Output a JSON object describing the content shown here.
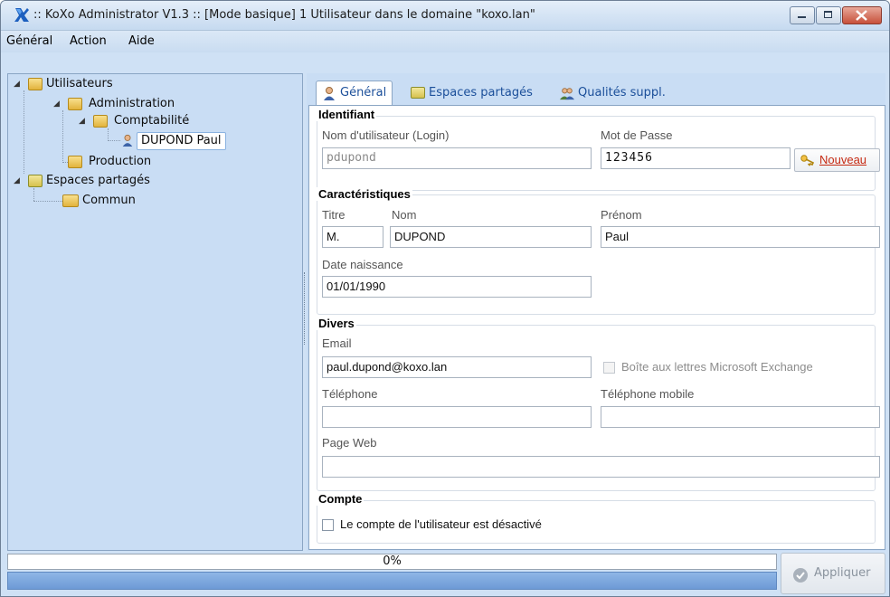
{
  "window": {
    "title": ":: KoXo Administrator V1.3 :: [Mode basique]  1 Utilisateur dans le domaine \"koxo.lan\"",
    "controls": {
      "minimize": "minimize-icon",
      "maximize": "maximize-icon",
      "close": "close-icon"
    }
  },
  "menu": {
    "items": [
      {
        "label": "Général"
      },
      {
        "label": "Action"
      },
      {
        "label": "Aide"
      }
    ]
  },
  "tree": {
    "utilisateurs": "Utilisateurs",
    "administration": "Administration",
    "comptabilite": "Comptabilité",
    "user": "DUPOND Paul",
    "production": "Production",
    "espaces": "Espaces partagés",
    "commun": "Commun"
  },
  "tabs": [
    {
      "label": "Général",
      "icon": "user-icon",
      "active": true
    },
    {
      "label": "Espaces partagés",
      "icon": "shared-folder-icon",
      "active": false
    },
    {
      "label": "Qualités suppl.",
      "icon": "users-icon",
      "active": false
    }
  ],
  "identifiant": {
    "legend": "Identifiant",
    "login_label": "Nom d'utilisateur (Login)",
    "login_value": "pdupond",
    "password_label": "Mot de Passe",
    "password_value": "123456",
    "new_button": "Nouveau"
  },
  "caracteristiques": {
    "legend": "Caractéristiques",
    "titre_label": "Titre",
    "titre_value": "M.",
    "nom_label": "Nom",
    "nom_value": "DUPOND",
    "prenom_label": "Prénom",
    "prenom_value": "Paul",
    "naissance_label": "Date naissance",
    "naissance_value": "01/01/1990"
  },
  "divers": {
    "legend": "Divers",
    "email_label": "Email",
    "email_value": "paul.dupond@koxo.lan",
    "exchange_label": "Boîte aux lettres Microsoft Exchange",
    "telephone_label": "Téléphone",
    "telephone_value": "",
    "mobile_label": "Téléphone mobile",
    "mobile_value": "",
    "web_label": "Page Web",
    "web_value": ""
  },
  "compte": {
    "legend": "Compte",
    "disabled_label": "Le compte de l'utilisateur est désactivé"
  },
  "progress": {
    "value": 0,
    "text": "0%"
  },
  "apply_button": "Appliquer"
}
